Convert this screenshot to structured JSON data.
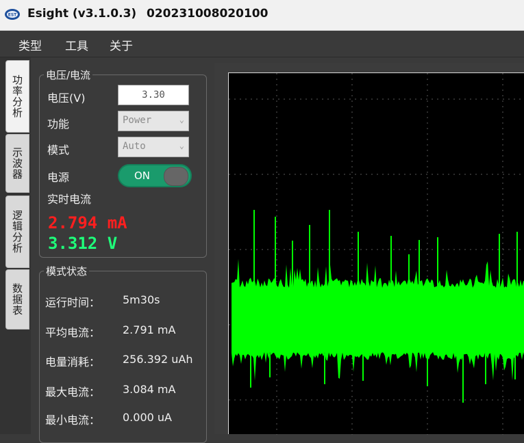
{
  "window": {
    "title": "Esight (v3.1.0.3)",
    "serial": "020231008020100"
  },
  "menu": [
    "类型",
    "工具",
    "关于"
  ],
  "side_tabs": [
    {
      "label": "功率分析",
      "active": true
    },
    {
      "label": "示波器",
      "active": false
    },
    {
      "label": "逻辑分析",
      "active": false
    },
    {
      "label": "数据表",
      "active": false
    }
  ],
  "voltage_current": {
    "title": "电压/电流",
    "voltage_label": "电压(V)",
    "voltage_value": "3.30",
    "function_label": "功能",
    "function_value": "Power",
    "mode_label": "模式",
    "mode_value": "Auto",
    "power_label": "电源",
    "power_state": "ON",
    "realtime_label": "实时电流",
    "live_current": "2.794 mA",
    "live_voltage": "3.312 V"
  },
  "mode_status": {
    "title": "模式状态",
    "rows": [
      {
        "label": "运行时间：",
        "value": "5m30s"
      },
      {
        "label": "平均电流：",
        "value": "2.791 mA"
      },
      {
        "label": "电量消耗：",
        "value": "256.392 uAh"
      },
      {
        "label": "最大电流：",
        "value": "3.084 mA"
      },
      {
        "label": "最小电流：",
        "value": "0.000 uA"
      }
    ]
  },
  "colors": {
    "trace": "#00ff00",
    "current_readout": "#ff1f1f",
    "voltage_readout": "#1fff7a",
    "toggle_on": "#1a9b6c"
  }
}
